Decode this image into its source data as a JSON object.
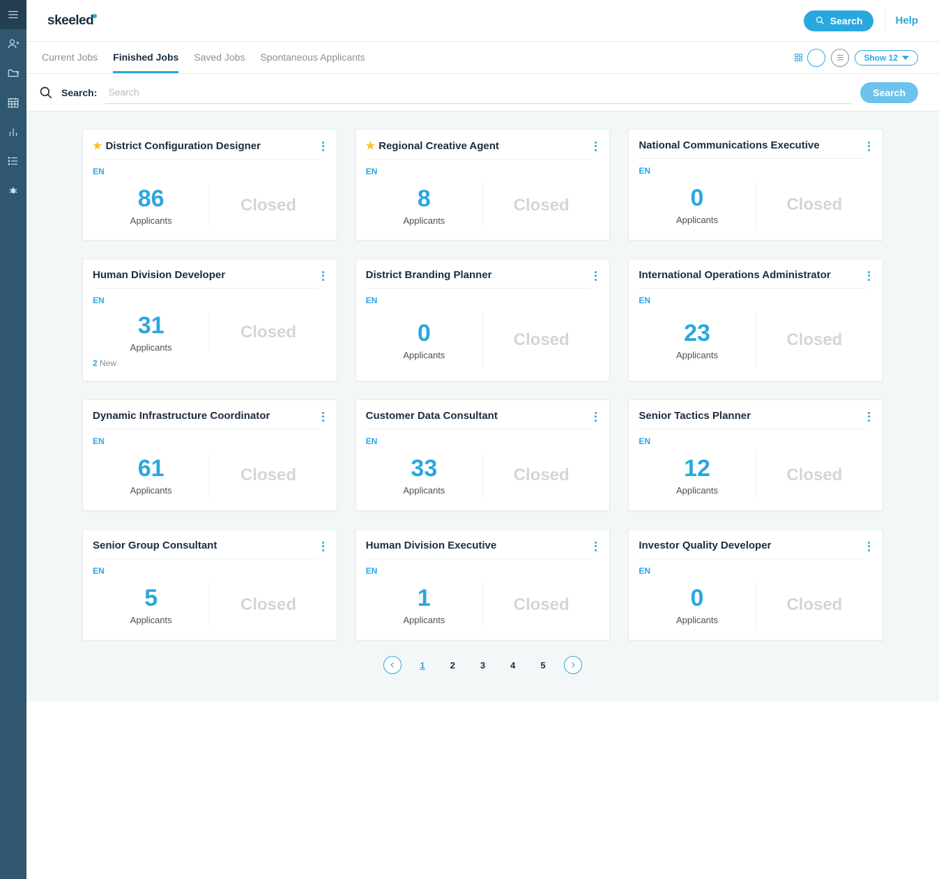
{
  "brand": "skeeled",
  "header": {
    "search": "Search",
    "help": "Help"
  },
  "tabs": [
    {
      "label": "Current Jobs",
      "active": false
    },
    {
      "label": "Finished Jobs",
      "active": true
    },
    {
      "label": "Saved Jobs",
      "active": false
    },
    {
      "label": "Spontaneous Applicants",
      "active": false
    }
  ],
  "show_label": "Show 12",
  "searchRow": {
    "label": "Search:",
    "placeholder": "Search",
    "button": "Search"
  },
  "applicants_label": "Applicants",
  "closed_label": "Closed",
  "new_label": "New",
  "jobs": [
    {
      "title": "District Configuration Designer",
      "starred": true,
      "lang": "EN",
      "applicants": 86,
      "status": "Closed"
    },
    {
      "title": "Regional Creative Agent",
      "starred": true,
      "lang": "EN",
      "applicants": 8,
      "status": "Closed"
    },
    {
      "title": "National Communications Executive",
      "starred": false,
      "lang": "EN",
      "applicants": 0,
      "status": "Closed"
    },
    {
      "title": "Human Division Developer",
      "starred": false,
      "lang": "EN",
      "applicants": 31,
      "status": "Closed",
      "new": 2
    },
    {
      "title": "District Branding Planner",
      "starred": false,
      "lang": "EN",
      "applicants": 0,
      "status": "Closed"
    },
    {
      "title": "International Operations Administrator",
      "starred": false,
      "lang": "EN",
      "applicants": 23,
      "status": "Closed"
    },
    {
      "title": "Dynamic Infrastructure Coordinator",
      "starred": false,
      "lang": "EN",
      "applicants": 61,
      "status": "Closed"
    },
    {
      "title": "Customer Data Consultant",
      "starred": false,
      "lang": "EN",
      "applicants": 33,
      "status": "Closed"
    },
    {
      "title": "Senior Tactics Planner",
      "starred": false,
      "lang": "EN",
      "applicants": 12,
      "status": "Closed"
    },
    {
      "title": "Senior Group Consultant",
      "starred": false,
      "lang": "EN",
      "applicants": 5,
      "status": "Closed"
    },
    {
      "title": "Human Division Executive",
      "starred": false,
      "lang": "EN",
      "applicants": 1,
      "status": "Closed"
    },
    {
      "title": "Investor Quality Developer",
      "starred": false,
      "lang": "EN",
      "applicants": 0,
      "status": "Closed"
    }
  ],
  "pagination": {
    "pages": [
      "1",
      "2",
      "3",
      "4",
      "5"
    ],
    "current": "1"
  }
}
